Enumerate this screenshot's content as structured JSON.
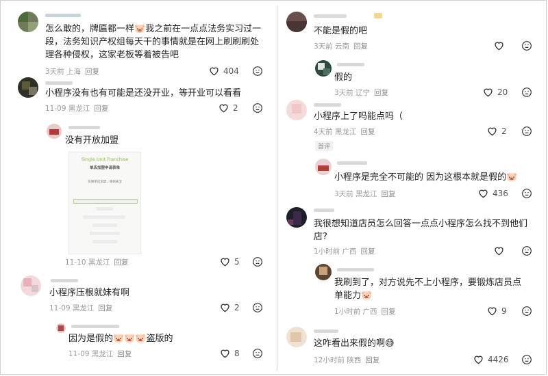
{
  "left": [
    {
      "text": "怎么敢的，牌匾都一样🐷我之前在一点点法务实习过一段，法务知识产权组每天干的事情就是在网上刷刷刷处理各种侵权，这家老板等着被告吧",
      "time": "3天前",
      "location": "上海",
      "reply": "回复",
      "likes": "404"
    },
    {
      "text": "小程序没有也有可能是还没开业，等开业可以看看",
      "time": "11-09",
      "location": "黑龙江",
      "reply": "回复",
      "likes": "2"
    },
    {
      "text": "没有开放加盟",
      "time": "11-10",
      "location": "黑龙江",
      "reply": "回复",
      "likes": "5",
      "image": {
        "title": "Single Unit Franchise",
        "subtitle": "单店加盟申请表单",
        "note": "仅限单店加盟，感谢关注"
      }
    },
    {
      "text": "小程序压根就妹有啊",
      "time": "11-09",
      "location": "黑龙江",
      "reply": "回复",
      "likes": "2"
    },
    {
      "text": "因为是假的🐷🐷🐷盗版的",
      "time": "11-09",
      "location": "黑龙江",
      "reply": "回复",
      "likes": "8"
    }
  ],
  "right": [
    {
      "text": "不能是假的吧",
      "time": "3天前",
      "location": "云南",
      "reply": "回复",
      "likes": ""
    },
    {
      "text": "假的",
      "time": "3天前",
      "location": "辽宁",
      "reply": "回复",
      "likes": "20"
    },
    {
      "text": "小程序上了吗能点吗（",
      "time": "4天前",
      "location": "黑龙江",
      "reply": "回复",
      "likes": "2",
      "tag": "首评"
    },
    {
      "text": "小程序是完全不可能的 因为这根本就是假的🐷",
      "time": "3天前",
      "location": "黑龙江",
      "reply": "回复",
      "likes": "436"
    },
    {
      "text": "我很想知道店员怎么回答一点点小程序怎么找不到他们店?",
      "time": "1小时前",
      "location": "广西",
      "reply": "回复",
      "likes": ""
    },
    {
      "text": "我刷到了，对方说先不上小程序，要锻炼店员点单能力🐷",
      "time": "1小时前",
      "location": "广西",
      "reply": "回复",
      "likes": "9"
    },
    {
      "text": "这咋看出来假的啊😅",
      "time": "12小时前",
      "location": "陕西",
      "reply": "回复",
      "likes": "4426"
    }
  ],
  "icons": {
    "like": "heart-outline-icon",
    "dislike": "dislike-face-icon"
  }
}
